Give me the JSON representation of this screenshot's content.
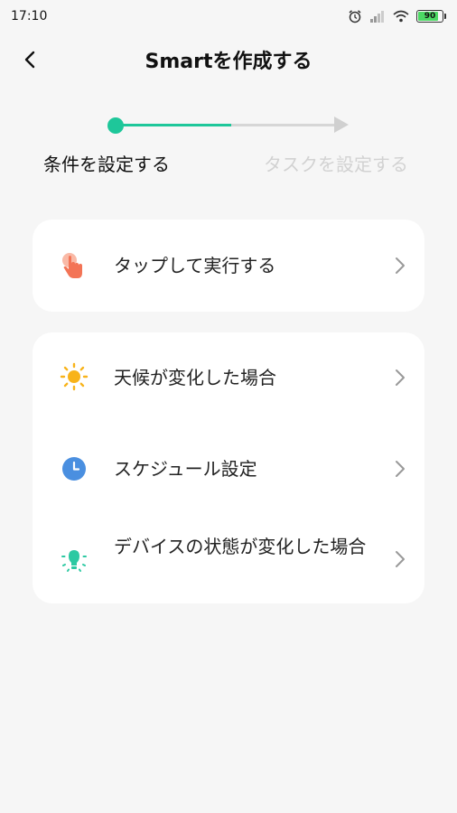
{
  "status_bar": {
    "time": "17:10",
    "battery_level": "90",
    "battery_color": "#4cd964",
    "icons": [
      "alarm-icon",
      "signal-icon",
      "wifi-icon",
      "battery-icon"
    ]
  },
  "header": {
    "title": "Smartを作成する",
    "back_icon": "chevron-left-icon"
  },
  "stepper": {
    "steps": [
      {
        "label": "条件を設定する",
        "active": true
      },
      {
        "label": "タスクを設定する",
        "active": false
      }
    ],
    "accent_color": "#1ec79a",
    "inactive_color": "#d2d2d2"
  },
  "condition_groups": [
    {
      "items": [
        {
          "label": "タップして実行する",
          "icon": "tap-hand-icon",
          "icon_color": "#f37456"
        }
      ]
    },
    {
      "items": [
        {
          "label": "天候が変化した場合",
          "icon": "sun-icon",
          "icon_color": "#f8b31a"
        },
        {
          "label": "スケジュール設定",
          "icon": "clock-icon",
          "icon_color": "#4a8fe0"
        },
        {
          "label": "デバイスの状態が変化した場合",
          "icon": "bulb-icon",
          "icon_color": "#2cc9a2"
        }
      ]
    }
  ]
}
